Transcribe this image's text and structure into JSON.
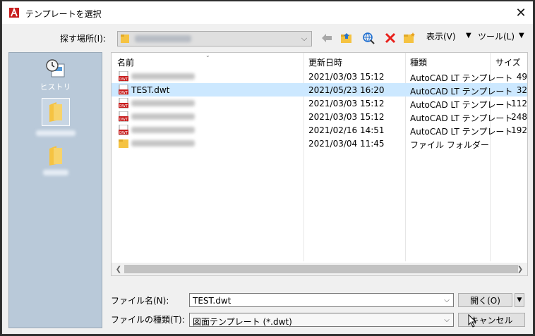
{
  "window": {
    "title": "テンプレートを選択",
    "close_glyph": "✕"
  },
  "toolbar": {
    "look_in_label": "探す場所(I):",
    "view_label": "表示(V)",
    "tools_label": "ツール(L)",
    "dropdown_glyph": "▼"
  },
  "places": [
    {
      "label": "ヒストリ"
    }
  ],
  "columns": [
    "名前",
    "更新日時",
    "種類",
    "サイズ"
  ],
  "files": [
    {
      "name": "",
      "date": "2021/03/03 15:12",
      "type": "AutoCAD LT テンプレート",
      "size": "49",
      "selected": false
    },
    {
      "name": "TEST.dwt",
      "date": "2021/05/23 16:20",
      "type": "AutoCAD LT テンプレート",
      "size": "32",
      "selected": true
    },
    {
      "name": "",
      "date": "2021/03/03 15:12",
      "type": "AutoCAD LT テンプレート",
      "size": "112",
      "selected": false
    },
    {
      "name": "",
      "date": "2021/03/03 15:12",
      "type": "AutoCAD LT テンプレート",
      "size": "248",
      "selected": false
    },
    {
      "name": "",
      "date": "2021/02/16 14:51",
      "type": "AutoCAD LT テンプレート",
      "size": "192",
      "selected": false
    },
    {
      "name": "",
      "date": "2021/03/04 11:45",
      "type": "ファイル フォルダー",
      "size": "",
      "selected": false,
      "folder": true
    }
  ],
  "footer": {
    "filename_label": "ファイル名(N):",
    "filename_value": "TEST.dwt",
    "filetype_label": "ファイルの種類(T):",
    "filetype_value": "図面テンプレート (*.dwt)",
    "open_label": "開く(O)",
    "cancel_label": "キャンセル"
  },
  "colors": {
    "accent_red": "#e8211c",
    "selection": "#cce8ff",
    "places_bg": "#b9c9d9",
    "folder": "#f5c342"
  }
}
